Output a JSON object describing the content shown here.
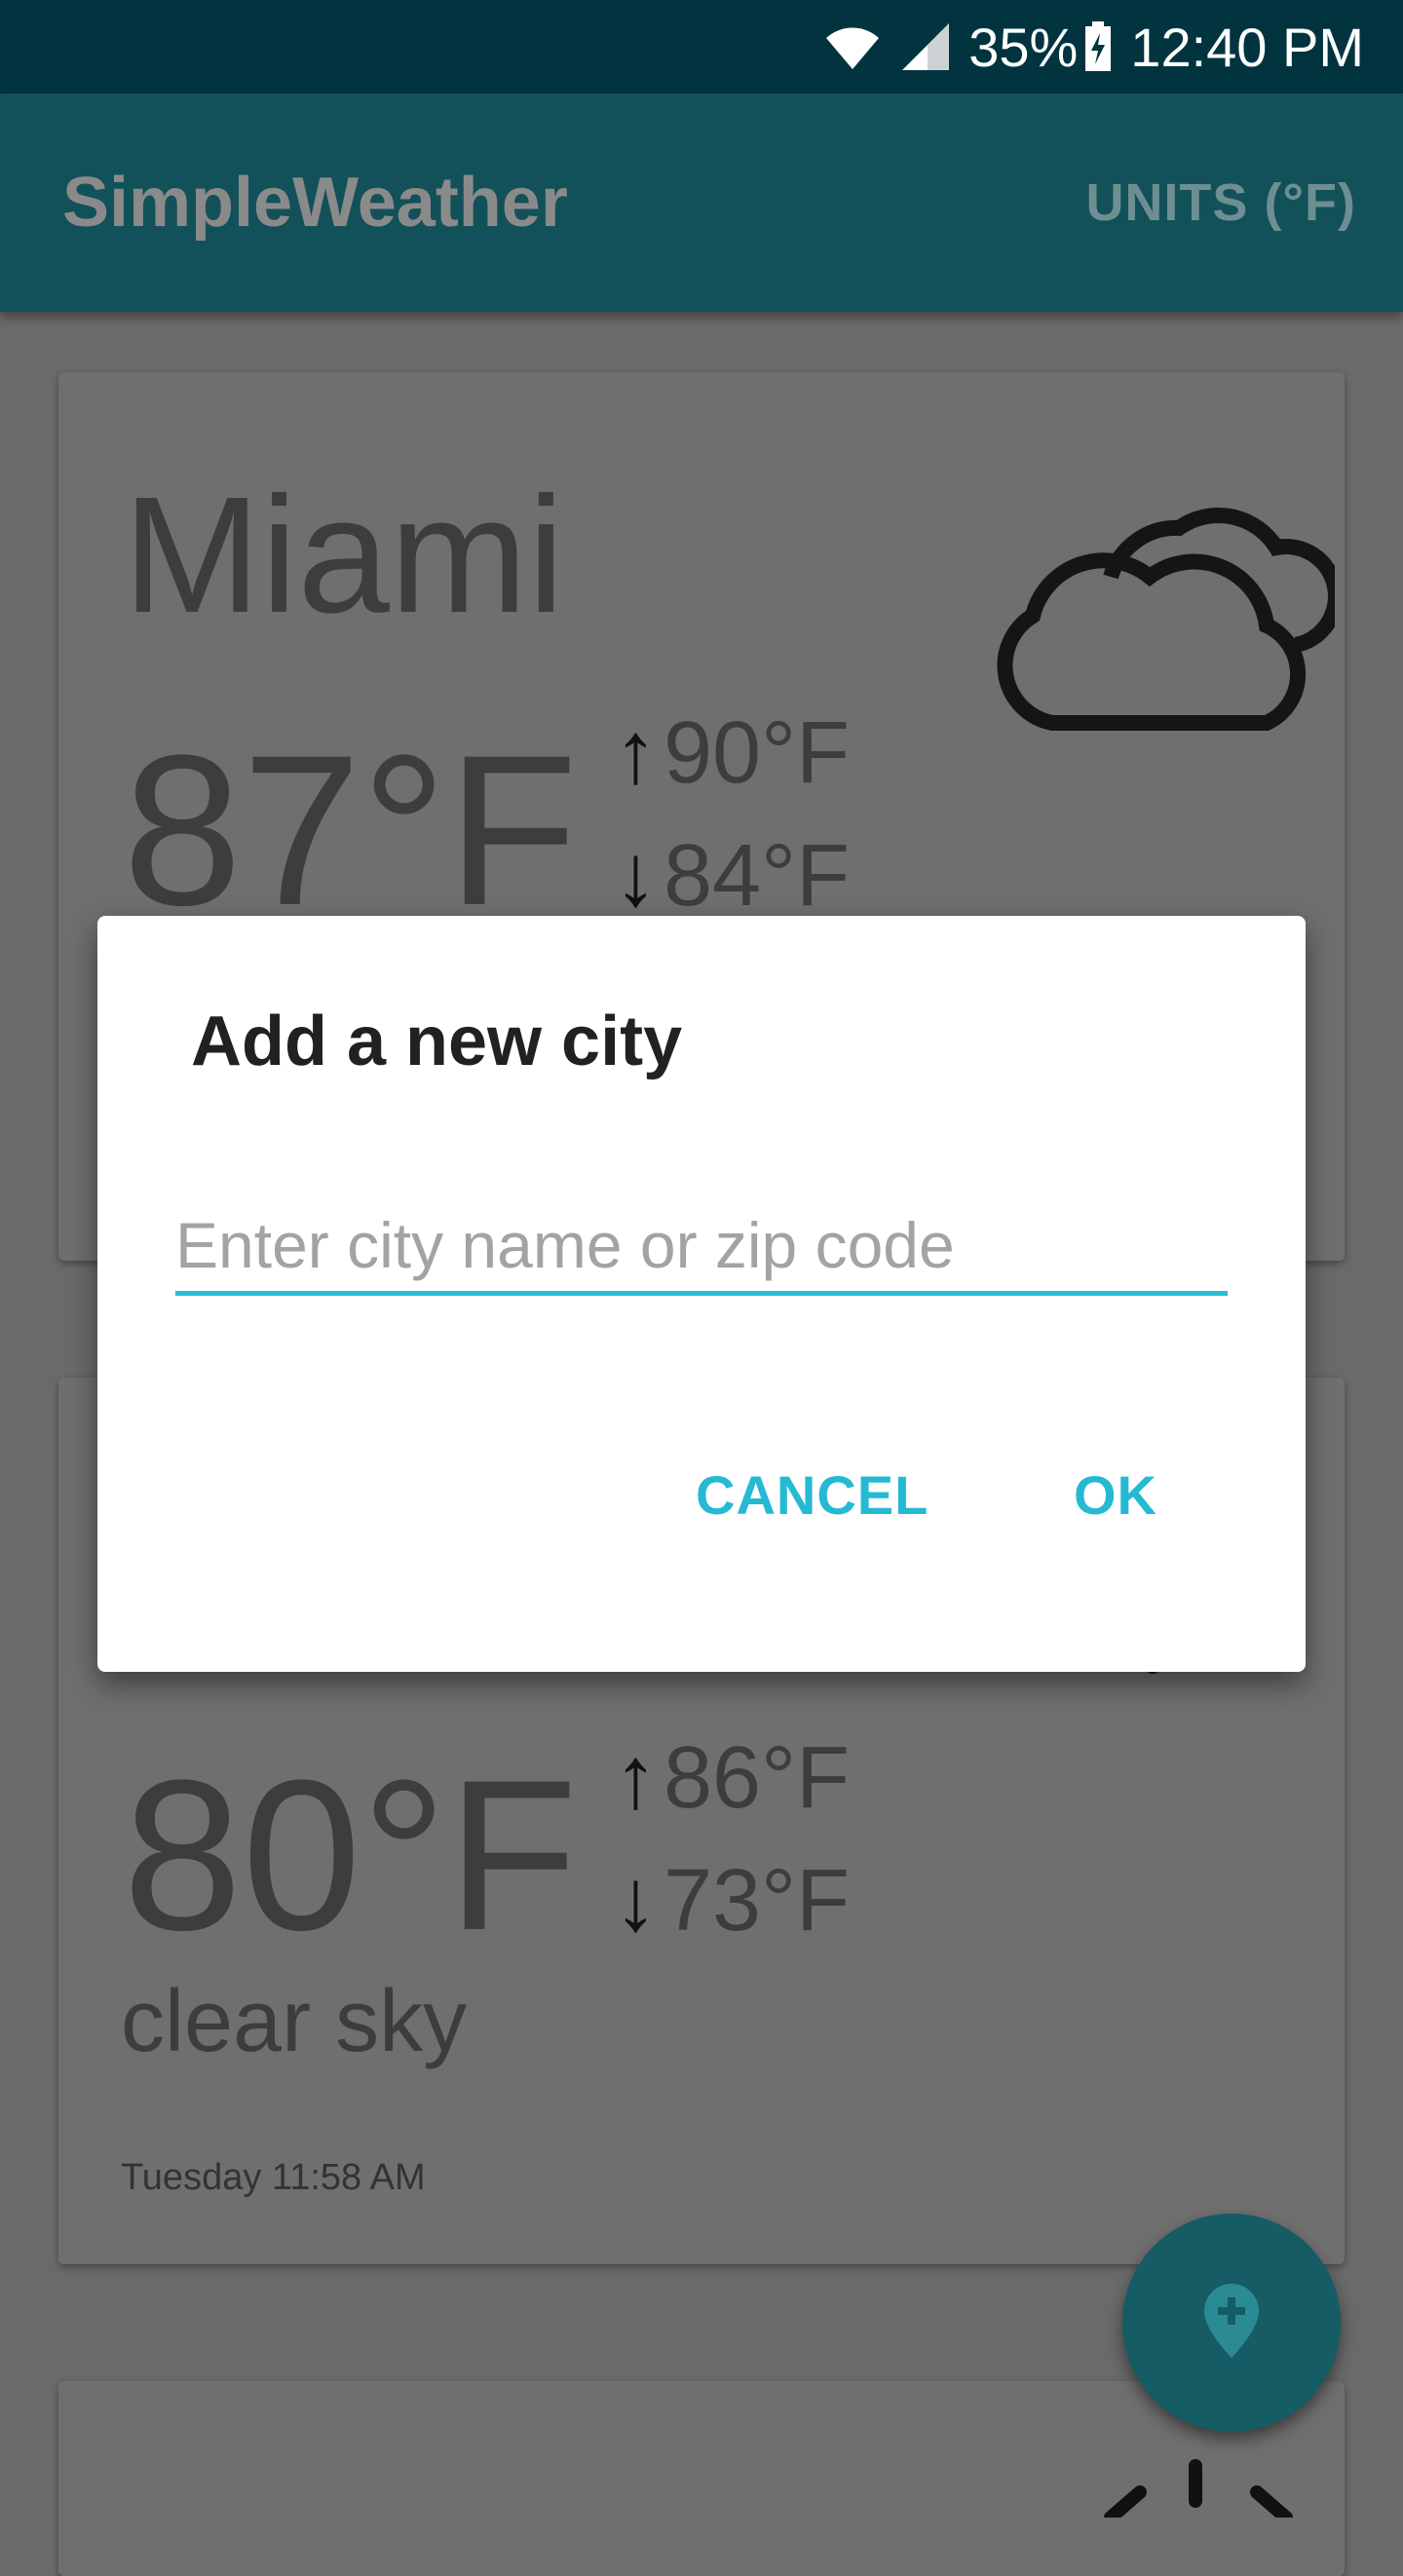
{
  "status_bar": {
    "battery": "35%",
    "time": "12:40 PM",
    "icons": [
      "wifi-icon",
      "signal-icon",
      "battery-charging-icon"
    ]
  },
  "app_bar": {
    "title": "SimpleWeather",
    "units_button": "UNITS (°F)"
  },
  "cards": [
    {
      "city": "Miami",
      "temperature": "87°F",
      "high": "90°F",
      "low": "84°F",
      "icon": "cloudy-icon"
    },
    {
      "temperature": "80°F",
      "high": "86°F",
      "low": "73°F",
      "description": "clear sky",
      "time": "Tuesday 11:58 AM",
      "icon": "sun-icon"
    }
  ],
  "dialog": {
    "title": "Add a new city",
    "input_placeholder": "Enter city name or zip code",
    "input_value": "",
    "cancel_label": "CANCEL",
    "ok_label": "OK"
  },
  "fab": {
    "icon": "add-location-icon"
  },
  "colors": {
    "status_bar": "#01343f",
    "app_bar": "#125159",
    "accent": "#26c0d6",
    "scrim_background": "#6a6a6a",
    "dialog": "#ffffff"
  }
}
